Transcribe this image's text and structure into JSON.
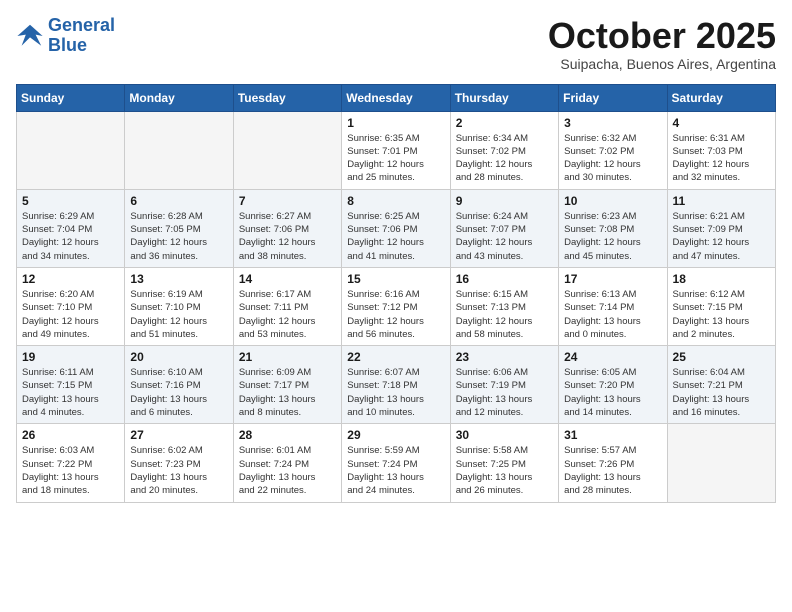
{
  "logo": {
    "line1": "General",
    "line2": "Blue"
  },
  "title": "October 2025",
  "subtitle": "Suipacha, Buenos Aires, Argentina",
  "days_of_week": [
    "Sunday",
    "Monday",
    "Tuesday",
    "Wednesday",
    "Thursday",
    "Friday",
    "Saturday"
  ],
  "weeks": [
    {
      "shaded": false,
      "days": [
        {
          "num": "",
          "info": ""
        },
        {
          "num": "",
          "info": ""
        },
        {
          "num": "",
          "info": ""
        },
        {
          "num": "1",
          "info": "Sunrise: 6:35 AM\nSunset: 7:01 PM\nDaylight: 12 hours\nand 25 minutes."
        },
        {
          "num": "2",
          "info": "Sunrise: 6:34 AM\nSunset: 7:02 PM\nDaylight: 12 hours\nand 28 minutes."
        },
        {
          "num": "3",
          "info": "Sunrise: 6:32 AM\nSunset: 7:02 PM\nDaylight: 12 hours\nand 30 minutes."
        },
        {
          "num": "4",
          "info": "Sunrise: 6:31 AM\nSunset: 7:03 PM\nDaylight: 12 hours\nand 32 minutes."
        }
      ]
    },
    {
      "shaded": true,
      "days": [
        {
          "num": "5",
          "info": "Sunrise: 6:29 AM\nSunset: 7:04 PM\nDaylight: 12 hours\nand 34 minutes."
        },
        {
          "num": "6",
          "info": "Sunrise: 6:28 AM\nSunset: 7:05 PM\nDaylight: 12 hours\nand 36 minutes."
        },
        {
          "num": "7",
          "info": "Sunrise: 6:27 AM\nSunset: 7:06 PM\nDaylight: 12 hours\nand 38 minutes."
        },
        {
          "num": "8",
          "info": "Sunrise: 6:25 AM\nSunset: 7:06 PM\nDaylight: 12 hours\nand 41 minutes."
        },
        {
          "num": "9",
          "info": "Sunrise: 6:24 AM\nSunset: 7:07 PM\nDaylight: 12 hours\nand 43 minutes."
        },
        {
          "num": "10",
          "info": "Sunrise: 6:23 AM\nSunset: 7:08 PM\nDaylight: 12 hours\nand 45 minutes."
        },
        {
          "num": "11",
          "info": "Sunrise: 6:21 AM\nSunset: 7:09 PM\nDaylight: 12 hours\nand 47 minutes."
        }
      ]
    },
    {
      "shaded": false,
      "days": [
        {
          "num": "12",
          "info": "Sunrise: 6:20 AM\nSunset: 7:10 PM\nDaylight: 12 hours\nand 49 minutes."
        },
        {
          "num": "13",
          "info": "Sunrise: 6:19 AM\nSunset: 7:10 PM\nDaylight: 12 hours\nand 51 minutes."
        },
        {
          "num": "14",
          "info": "Sunrise: 6:17 AM\nSunset: 7:11 PM\nDaylight: 12 hours\nand 53 minutes."
        },
        {
          "num": "15",
          "info": "Sunrise: 6:16 AM\nSunset: 7:12 PM\nDaylight: 12 hours\nand 56 minutes."
        },
        {
          "num": "16",
          "info": "Sunrise: 6:15 AM\nSunset: 7:13 PM\nDaylight: 12 hours\nand 58 minutes."
        },
        {
          "num": "17",
          "info": "Sunrise: 6:13 AM\nSunset: 7:14 PM\nDaylight: 13 hours\nand 0 minutes."
        },
        {
          "num": "18",
          "info": "Sunrise: 6:12 AM\nSunset: 7:15 PM\nDaylight: 13 hours\nand 2 minutes."
        }
      ]
    },
    {
      "shaded": true,
      "days": [
        {
          "num": "19",
          "info": "Sunrise: 6:11 AM\nSunset: 7:15 PM\nDaylight: 13 hours\nand 4 minutes."
        },
        {
          "num": "20",
          "info": "Sunrise: 6:10 AM\nSunset: 7:16 PM\nDaylight: 13 hours\nand 6 minutes."
        },
        {
          "num": "21",
          "info": "Sunrise: 6:09 AM\nSunset: 7:17 PM\nDaylight: 13 hours\nand 8 minutes."
        },
        {
          "num": "22",
          "info": "Sunrise: 6:07 AM\nSunset: 7:18 PM\nDaylight: 13 hours\nand 10 minutes."
        },
        {
          "num": "23",
          "info": "Sunrise: 6:06 AM\nSunset: 7:19 PM\nDaylight: 13 hours\nand 12 minutes."
        },
        {
          "num": "24",
          "info": "Sunrise: 6:05 AM\nSunset: 7:20 PM\nDaylight: 13 hours\nand 14 minutes."
        },
        {
          "num": "25",
          "info": "Sunrise: 6:04 AM\nSunset: 7:21 PM\nDaylight: 13 hours\nand 16 minutes."
        }
      ]
    },
    {
      "shaded": false,
      "days": [
        {
          "num": "26",
          "info": "Sunrise: 6:03 AM\nSunset: 7:22 PM\nDaylight: 13 hours\nand 18 minutes."
        },
        {
          "num": "27",
          "info": "Sunrise: 6:02 AM\nSunset: 7:23 PM\nDaylight: 13 hours\nand 20 minutes."
        },
        {
          "num": "28",
          "info": "Sunrise: 6:01 AM\nSunset: 7:24 PM\nDaylight: 13 hours\nand 22 minutes."
        },
        {
          "num": "29",
          "info": "Sunrise: 5:59 AM\nSunset: 7:24 PM\nDaylight: 13 hours\nand 24 minutes."
        },
        {
          "num": "30",
          "info": "Sunrise: 5:58 AM\nSunset: 7:25 PM\nDaylight: 13 hours\nand 26 minutes."
        },
        {
          "num": "31",
          "info": "Sunrise: 5:57 AM\nSunset: 7:26 PM\nDaylight: 13 hours\nand 28 minutes."
        },
        {
          "num": "",
          "info": ""
        }
      ]
    }
  ]
}
